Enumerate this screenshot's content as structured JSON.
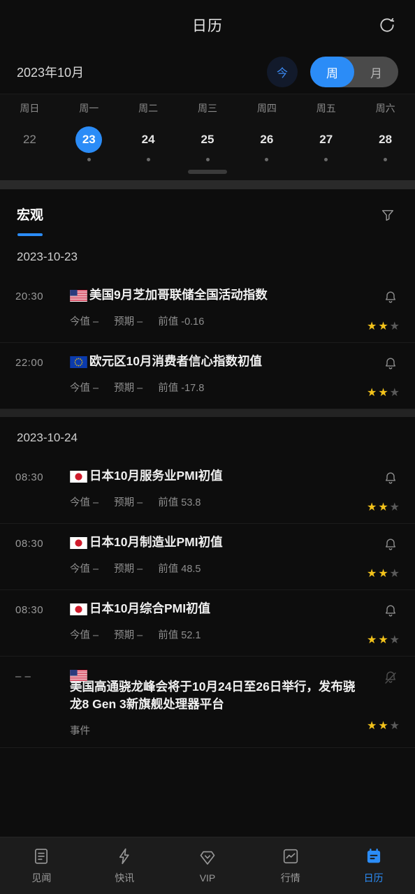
{
  "header": {
    "title": "日历",
    "refresh_icon": "refresh-icon"
  },
  "monthbar": {
    "month_label": "2023年10月",
    "today_button": "今",
    "view_toggle": {
      "options": [
        "周",
        "月"
      ],
      "selected": "周"
    }
  },
  "week_strip": {
    "weekdays": [
      "周日",
      "周一",
      "周二",
      "周三",
      "周四",
      "周五",
      "周六"
    ],
    "days": [
      {
        "num": "22",
        "selected": false,
        "dim": true,
        "has_event": false
      },
      {
        "num": "23",
        "selected": true,
        "dim": false,
        "has_event": true
      },
      {
        "num": "24",
        "selected": false,
        "dim": false,
        "has_event": true
      },
      {
        "num": "25",
        "selected": false,
        "dim": false,
        "has_event": true
      },
      {
        "num": "26",
        "selected": false,
        "dim": false,
        "has_event": true
      },
      {
        "num": "27",
        "selected": false,
        "dim": false,
        "has_event": true
      },
      {
        "num": "28",
        "selected": false,
        "dim": false,
        "has_event": true
      }
    ]
  },
  "tabs": {
    "items": [
      {
        "label": "宏观",
        "active": true
      }
    ],
    "filter_icon": "filter-icon"
  },
  "groups": [
    {
      "date": "2023-10-23",
      "events": [
        {
          "time": "20:30",
          "flag": "us",
          "title": "美国9月芝加哥联储全国活动指数",
          "actual_label": "今值",
          "actual_value": "–",
          "forecast_label": "预期",
          "forecast_value": "–",
          "previous_label": "前值",
          "previous_value": "-0.16",
          "bell": "bell-icon",
          "stars_filled": 2,
          "stars_total": 3
        },
        {
          "time": "22:00",
          "flag": "eu",
          "title": "欧元区10月消费者信心指数初值",
          "actual_label": "今值",
          "actual_value": "–",
          "forecast_label": "预期",
          "forecast_value": "–",
          "previous_label": "前值",
          "previous_value": "-17.8",
          "bell": "bell-icon",
          "stars_filled": 2,
          "stars_total": 3
        }
      ]
    },
    {
      "date": "2023-10-24",
      "events": [
        {
          "time": "08:30",
          "flag": "jp",
          "title": "日本10月服务业PMI初值",
          "actual_label": "今值",
          "actual_value": "–",
          "forecast_label": "预期",
          "forecast_value": "–",
          "previous_label": "前值",
          "previous_value": "53.8",
          "bell": "bell-icon",
          "stars_filled": 2,
          "stars_total": 3
        },
        {
          "time": "08:30",
          "flag": "jp",
          "title": "日本10月制造业PMI初值",
          "actual_label": "今值",
          "actual_value": "–",
          "forecast_label": "预期",
          "forecast_value": "–",
          "previous_label": "前值",
          "previous_value": "48.5",
          "bell": "bell-icon",
          "stars_filled": 2,
          "stars_total": 3
        },
        {
          "time": "08:30",
          "flag": "jp",
          "title": "日本10月综合PMI初值",
          "actual_label": "今值",
          "actual_value": "–",
          "forecast_label": "预期",
          "forecast_value": "–",
          "previous_label": "前值",
          "previous_value": "52.1",
          "bell": "bell-icon",
          "stars_filled": 2,
          "stars_total": 3
        },
        {
          "time": "– –",
          "flag": "us",
          "title": "美国高通骁龙峰会将于10月24日至26日举行，发布骁龙8 Gen 3新旗舰处理器平台",
          "category_label": "事件",
          "bell": "bell-muted-icon",
          "stars_filled": 2,
          "stars_total": 3,
          "tall": true
        }
      ]
    }
  ],
  "bottom_nav": [
    {
      "label": "见闻",
      "icon": "news-icon",
      "active": false
    },
    {
      "label": "快讯",
      "icon": "flash-icon",
      "active": false
    },
    {
      "label": "VIP",
      "icon": "diamond-icon",
      "active": false
    },
    {
      "label": "行情",
      "icon": "market-chart-icon",
      "active": false
    },
    {
      "label": "日历",
      "icon": "calendar-icon",
      "active": true
    }
  ],
  "colors": {
    "accent": "#2b8cf7",
    "star": "#f2c21b",
    "background": "#0d0d0d",
    "nav_background": "#1c1c1c"
  }
}
